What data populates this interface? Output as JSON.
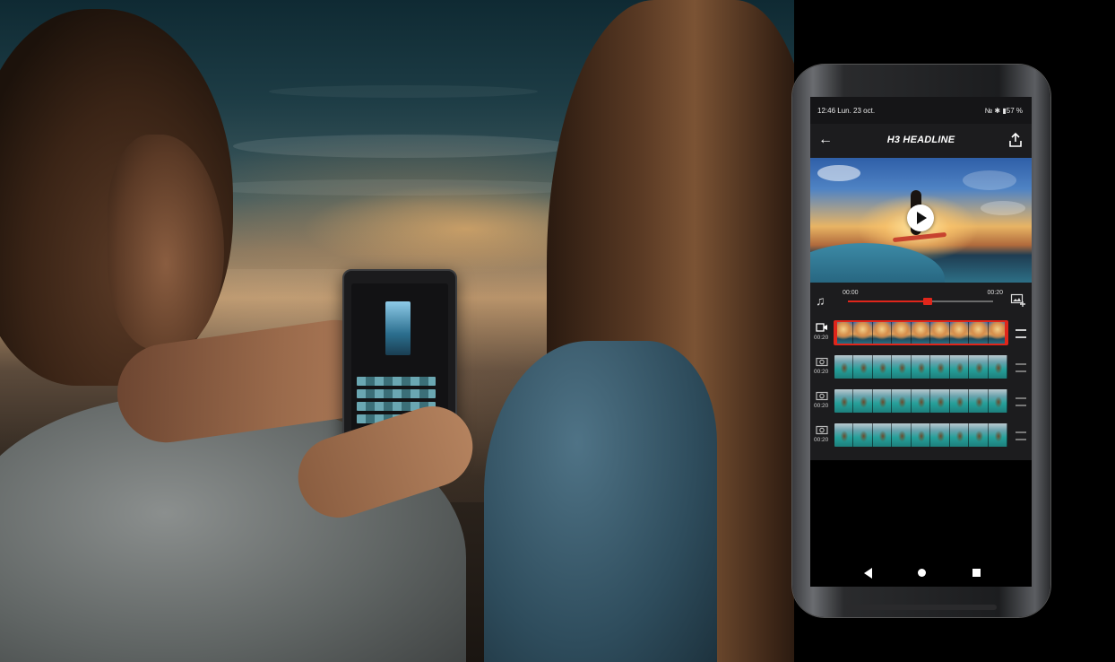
{
  "statusbar": {
    "time": "12:46 Lun. 23 oct.",
    "indicators": "№ ✱ ▮57 %",
    "battery_percent": 57
  },
  "appbar": {
    "title": "H3 HEADLINE",
    "back_icon": "arrow-left-icon",
    "share_icon": "share-icon"
  },
  "player": {
    "play_icon": "play-icon",
    "time_start": "00:00",
    "time_end": "00:20",
    "progress": 0.55
  },
  "tracks": [
    {
      "type": "video",
      "icon": "video-camera-icon",
      "duration": "00:20",
      "frames": 9,
      "selected": true
    },
    {
      "type": "photo",
      "icon": "camera-icon",
      "duration": "00:20",
      "frames": 9,
      "selected": false
    },
    {
      "type": "photo",
      "icon": "camera-icon",
      "duration": "00:20",
      "frames": 9,
      "selected": false
    },
    {
      "type": "photo",
      "icon": "camera-icon",
      "duration": "00:20",
      "frames": 9,
      "selected": false
    }
  ],
  "colors": {
    "accent": "#e0261b",
    "panel": "#1c1c1e",
    "background": "#000000"
  }
}
